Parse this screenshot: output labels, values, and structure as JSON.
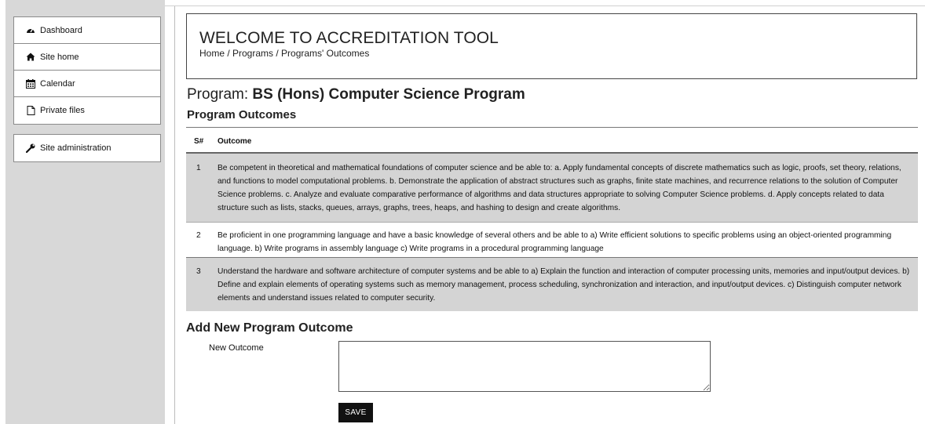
{
  "sidebar": {
    "items": [
      {
        "label": "Dashboard",
        "icon": "dashboard-icon"
      },
      {
        "label": "Site home",
        "icon": "home-icon"
      },
      {
        "label": "Calendar",
        "icon": "calendar-icon"
      },
      {
        "label": "Private files",
        "icon": "file-icon"
      }
    ],
    "admin": {
      "label": "Site administration",
      "icon": "wrench-icon"
    }
  },
  "header": {
    "title": "WELCOME TO ACCREDITATION TOOL",
    "breadcrumb": "Home / Programs / Programs' Outcomes"
  },
  "program": {
    "prefix": "Program:",
    "name": "BS (Hons) Computer Science Program"
  },
  "outcomes": {
    "heading": "Program Outcomes",
    "columns": {
      "num": "S#",
      "outcome": "Outcome"
    },
    "rows": [
      {
        "num": "1",
        "text": "Be competent in theoretical and mathematical foundations of computer science and be able to: a. Apply fundamental concepts of discrete mathematics such as logic, proofs, set theory, relations, and functions to model computational problems. b. Demonstrate the application of abstract structures such as graphs, finite state machines, and recurrence relations to the solution of Computer Science problems. c. Analyze and evaluate comparative performance of algorithms and data structures appropriate to solving Computer Science problems. d. Apply concepts related to data structure such as lists, stacks, queues, arrays, graphs, trees, heaps, and hashing to design and create algorithms."
      },
      {
        "num": "2",
        "text": "Be proficient in one programming language and have a basic knowledge of several others and be able to a) Write efficient solutions to specific problems using an object-oriented programming language. b) Write programs in assembly language c) Write programs in a procedural programming language"
      },
      {
        "num": "3",
        "text": "Understand the hardware and software architecture of computer systems and be able to a) Explain the function and interaction of computer processing units, memories and input/output devices. b) Define and explain elements of operating systems such as memory management, process scheduling, synchronization and interaction, and input/output devices. c) Distinguish computer network elements and understand issues related to computer security."
      }
    ]
  },
  "form": {
    "heading": "Add New Program Outcome",
    "label": "New Outcome",
    "value": "",
    "save_label": "SAVE"
  }
}
